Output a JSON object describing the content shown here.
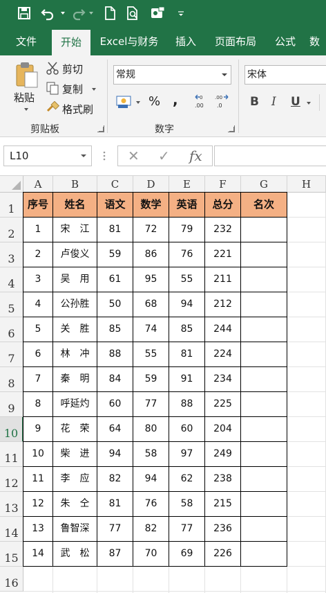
{
  "quick_access": {
    "icons": [
      "save-icon",
      "undo-icon",
      "redo-icon",
      "new-document-icon",
      "print-preview-icon",
      "touch-mode-icon",
      "customize-toolbar-icon"
    ]
  },
  "tabs": [
    {
      "label": "文件"
    },
    {
      "label": "开始"
    },
    {
      "label": "Excel与财务"
    },
    {
      "label": "插入"
    },
    {
      "label": "页面布局"
    },
    {
      "label": "公式"
    },
    {
      "label": "数"
    }
  ],
  "ribbon": {
    "clipboard": {
      "paste_label": "粘贴",
      "cut_label": "剪切",
      "copy_label": "复制",
      "format_painter_label": "格式刷",
      "group_label": "剪贴板"
    },
    "number": {
      "format_value": "常规",
      "percent_symbol": "%",
      "comma_symbol": ",",
      "group_label": "数字"
    },
    "font": {
      "font_name": "宋体",
      "bold": "B",
      "italic": "I",
      "underline": "U"
    }
  },
  "formula_bar": {
    "name_box": "L10",
    "cancel_symbol": "✕",
    "enter_symbol": "✓",
    "fx_symbol": "fx",
    "formula": ""
  },
  "sheet": {
    "columns": [
      "A",
      "B",
      "C",
      "D",
      "E",
      "F",
      "G",
      "H"
    ],
    "rows": [
      "1",
      "2",
      "3",
      "4",
      "5",
      "6",
      "7",
      "8",
      "9",
      "10",
      "11",
      "12",
      "13",
      "14",
      "15",
      "16"
    ],
    "selected_row": "10",
    "headers": [
      "序号",
      "姓名",
      "语文",
      "数学",
      "英语",
      "总分",
      "名次"
    ],
    "records": [
      [
        "1",
        "宋　江",
        "81",
        "72",
        "79",
        "232",
        ""
      ],
      [
        "2",
        "卢俊义",
        "59",
        "86",
        "76",
        "221",
        ""
      ],
      [
        "3",
        "吴　用",
        "61",
        "95",
        "55",
        "211",
        ""
      ],
      [
        "4",
        "公孙胜",
        "50",
        "68",
        "94",
        "212",
        ""
      ],
      [
        "5",
        "关　胜",
        "85",
        "74",
        "85",
        "244",
        ""
      ],
      [
        "6",
        "林　冲",
        "88",
        "55",
        "81",
        "224",
        ""
      ],
      [
        "7",
        "秦　明",
        "84",
        "59",
        "91",
        "234",
        ""
      ],
      [
        "8",
        "呼延灼",
        "60",
        "77",
        "88",
        "225",
        ""
      ],
      [
        "9",
        "花　荣",
        "64",
        "80",
        "60",
        "204",
        ""
      ],
      [
        "10",
        "柴　进",
        "94",
        "58",
        "97",
        "249",
        ""
      ],
      [
        "11",
        "李　应",
        "82",
        "94",
        "62",
        "238",
        ""
      ],
      [
        "12",
        "朱　仝",
        "81",
        "76",
        "58",
        "215",
        ""
      ],
      [
        "13",
        "鲁智深",
        "77",
        "82",
        "77",
        "236",
        ""
      ],
      [
        "14",
        "武　松",
        "87",
        "70",
        "69",
        "226",
        ""
      ]
    ]
  },
  "colors": {
    "accent": "#217346",
    "header_fill": "#f4b084"
  }
}
